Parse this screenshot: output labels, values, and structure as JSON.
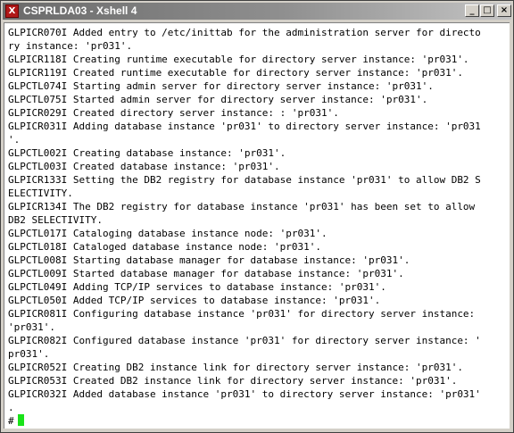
{
  "window": {
    "title": "CSPRLDA03 - Xshell 4",
    "icon": "xshell-app-icon",
    "controls": {
      "minimize": "_",
      "maximize": "□",
      "close": "×"
    }
  },
  "terminal": {
    "lines": [
      "GLPICR070I Added entry to /etc/inittab for the administration server for directo",
      "ry instance: 'pr031'.",
      "GLPICR118I Creating runtime executable for directory server instance: 'pr031'.",
      "GLPICR119I Created runtime executable for directory server instance: 'pr031'.",
      "GLPCTL074I Starting admin server for directory server instance: 'pr031'.",
      "GLPCTL075I Started admin server for directory server instance: 'pr031'.",
      "GLPICR029I Created directory server instance: : 'pr031'.",
      "GLPICR031I Adding database instance 'pr031' to directory server instance: 'pr031",
      "'.",
      "GLPCTL002I Creating database instance: 'pr031'.",
      "GLPCTL003I Created database instance: 'pr031'.",
      "GLPICR133I Setting the DB2 registry for database instance 'pr031' to allow DB2 S",
      "ELECTIVITY.",
      "GLPICR134I The DB2 registry for database instance 'pr031' has been set to allow",
      "DB2 SELECTIVITY.",
      "GLPCTL017I Cataloging database instance node: 'pr031'.",
      "GLPCTL018I Cataloged database instance node: 'pr031'.",
      "GLPCTL008I Starting database manager for database instance: 'pr031'.",
      "GLPCTL009I Started database manager for database instance: 'pr031'.",
      "GLPCTL049I Adding TCP/IP services to database instance: 'pr031'.",
      "GLPCTL050I Added TCP/IP services to database instance: 'pr031'.",
      "GLPICR081I Configuring database instance 'pr031' for directory server instance:",
      "'pr031'.",
      "GLPICR082I Configured database instance 'pr031' for directory server instance: '",
      "pr031'.",
      "GLPICR052I Creating DB2 instance link for directory server instance: 'pr031'.",
      "GLPICR053I Created DB2 instance link for directory server instance: 'pr031'.",
      "GLPICR032I Added database instance 'pr031' to directory server instance: 'pr031'",
      "."
    ],
    "prompt": "#",
    "cursor_color": "#19e319"
  }
}
